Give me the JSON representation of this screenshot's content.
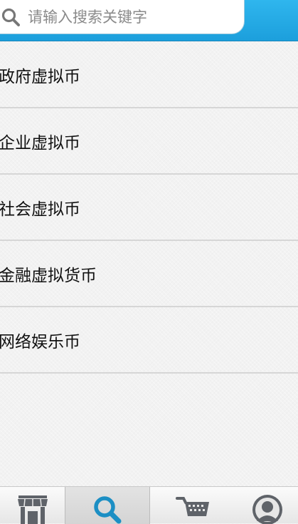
{
  "search": {
    "placeholder": "请输入搜索关键字",
    "value": ""
  },
  "categories": [
    {
      "label": "政府虚拟币"
    },
    {
      "label": "企业虚拟币"
    },
    {
      "label": "社会虚拟币"
    },
    {
      "label": "金融虚拟货币"
    },
    {
      "label": "网络娱乐币"
    }
  ],
  "tabbar": {
    "active_tab": "search",
    "tabs": [
      {
        "id": "store",
        "icon": "store-icon"
      },
      {
        "id": "search",
        "icon": "search-icon"
      },
      {
        "id": "cart",
        "icon": "cart-icon"
      },
      {
        "id": "profile",
        "icon": "user-icon"
      }
    ]
  },
  "colors": {
    "header_blue": "#1ea7e4",
    "active_icon_blue": "#1c8fc4",
    "icon_gray": "#5f6369",
    "divider": "#d6d6d6"
  }
}
